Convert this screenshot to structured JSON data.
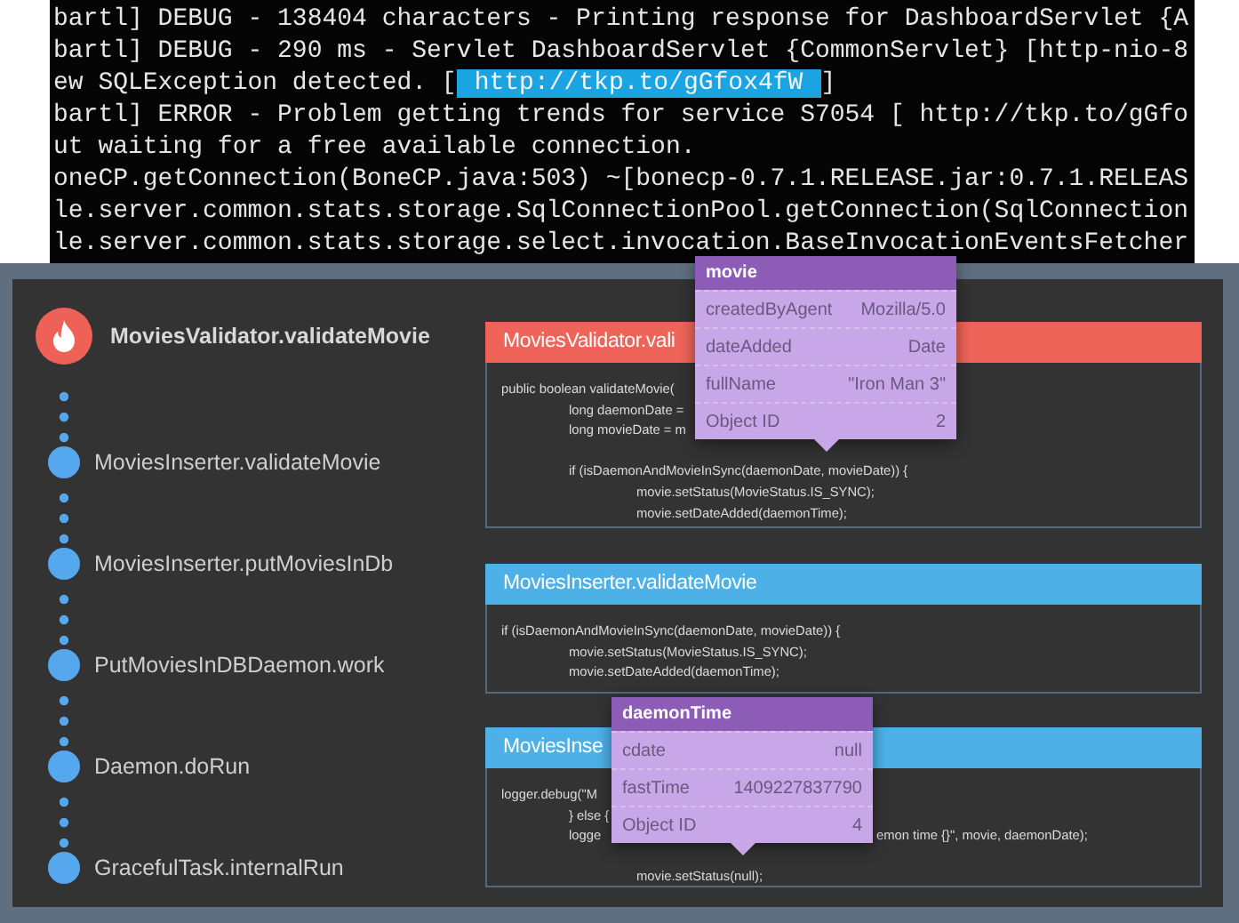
{
  "terminal": {
    "lines": [
      {
        "text": "bartl] DEBUG - 138404 characters - Printing response for DashboardServlet {A"
      },
      {
        "text": "bartl] DEBUG - 290 ms - Servlet DashboardServlet {CommonServlet} [http-nio-8"
      },
      {
        "text": "ew SQLException detected. [",
        "link": "http://tkp.to/gGfox4fW",
        "after": "]"
      },
      {
        "text": "bartl] ERROR - Problem getting trends for service S7054 [ http://tkp.to/gGfo"
      },
      {
        "text": "ut waiting for a free available connection."
      },
      {
        "text": "oneCP.getConnection(BoneCP.java:503) ~[bonecp-0.7.1.RELEASE.jar:0.7.1.RELEAS"
      },
      {
        "text": "le.server.common.stats.storage.SqlConnectionPool.getConnection(SqlConnection"
      },
      {
        "text": "le.server.common.stats.storage.select.invocation.BaseInvocationEventsFetcher"
      }
    ]
  },
  "trace": {
    "frames": [
      {
        "kind": "error",
        "label": "MoviesValidator.validateMovie"
      },
      {
        "kind": "call",
        "label": "MoviesInserter.validateMovie"
      },
      {
        "kind": "call",
        "label": "MoviesInserter.putMoviesInDb"
      },
      {
        "kind": "call",
        "label": "PutMoviesInDBDaemon.work"
      },
      {
        "kind": "call",
        "label": "Daemon.doRun"
      },
      {
        "kind": "call",
        "label": "GracefulTask.internalRun"
      }
    ]
  },
  "cards": [
    {
      "kind": "error",
      "title": "MoviesValidator.vali",
      "code": [
        {
          "kind": "code",
          "segments": [
            "public boolean validateMovie("
          ]
        },
        {
          "kind": "code",
          "segments": [
            "\tlong daemonDate ="
          ]
        },
        {
          "kind": "code",
          "segments": [
            "\tlong movieDate = m"
          ]
        },
        {
          "kind": "blank"
        },
        {
          "kind": "code",
          "segments": [
            "\tif (isDaemonAndMovieInSync(daemonDate, movieDate)) {"
          ]
        },
        {
          "kind": "code",
          "segments": [
            "\t\tmovie.setStatus(MovieStatus.IS_SYNC);"
          ]
        },
        {
          "kind": "code",
          "segments": [
            "\t\tmovie.setDateAdded(daemonTime);"
          ]
        }
      ],
      "tooltip": {
        "title": "movie",
        "rows": [
          {
            "key": "createdByAgent",
            "value": "Mozilla/5.0"
          },
          {
            "key": "dateAdded",
            "value": "Date"
          },
          {
            "key": "fullName",
            "value": "\"Iron Man 3\""
          },
          {
            "key": "Object ID",
            "value": "2"
          }
        ]
      }
    },
    {
      "kind": "call",
      "title": "MoviesInserter.validateMovie",
      "code": [
        {
          "kind": "code",
          "segments": [
            "if (isDaemonAndMovieInSync(daemonDate, movieDate)) {"
          ]
        },
        {
          "kind": "code",
          "segments": [
            "\tmovie.setStatus(MovieStatus.IS_SYNC);"
          ]
        },
        {
          "kind": "code",
          "segments": [
            "\tmovie.setDateAdded(daemonTime);"
          ]
        }
      ]
    },
    {
      "kind": "call",
      "title": "MoviesInse",
      "code": [
        {
          "kind": "code",
          "segments": [
            "logger.debug(\"M"
          ]
        },
        {
          "kind": "code",
          "segments": [
            "\t} else {"
          ]
        },
        {
          "kind": "code",
          "segments": [
            "\tlogge",
            "emon time {}\", movie, daemonDate);"
          ]
        },
        {
          "kind": "blank"
        },
        {
          "kind": "code",
          "segments": [
            "\t\tmovie.setStatus(null);"
          ]
        }
      ],
      "tooltip": {
        "title": "daemonTime",
        "rows": [
          {
            "key": "cdate",
            "value": "null"
          },
          {
            "key": "fastTime",
            "value": "1409227837790"
          },
          {
            "key": "Object ID",
            "value": "4"
          }
        ]
      }
    }
  ]
}
